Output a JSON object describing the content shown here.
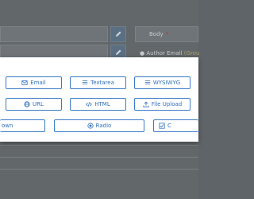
{
  "background": {
    "body_label": "Body",
    "author_label": "Author Email",
    "author_hint": "(Grou"
  },
  "modal": {
    "buttons": [
      {
        "label": "Email",
        "icon": "envelope-icon"
      },
      {
        "label": "Textarea",
        "icon": "list-icon"
      },
      {
        "label": "WYSIWYG",
        "icon": "list-icon"
      },
      {
        "label": "URL",
        "icon": "globe-icon"
      },
      {
        "label": "HTML",
        "icon": "code-icon"
      },
      {
        "label": "File Upload",
        "icon": "upload-icon"
      },
      {
        "label": "own",
        "icon": ""
      },
      {
        "label": "Radio",
        "icon": "radio-icon"
      },
      {
        "label": "C",
        "icon": "checkbox-icon"
      }
    ]
  },
  "colors": {
    "accent": "#2f6fbf",
    "required": "#b33333"
  }
}
